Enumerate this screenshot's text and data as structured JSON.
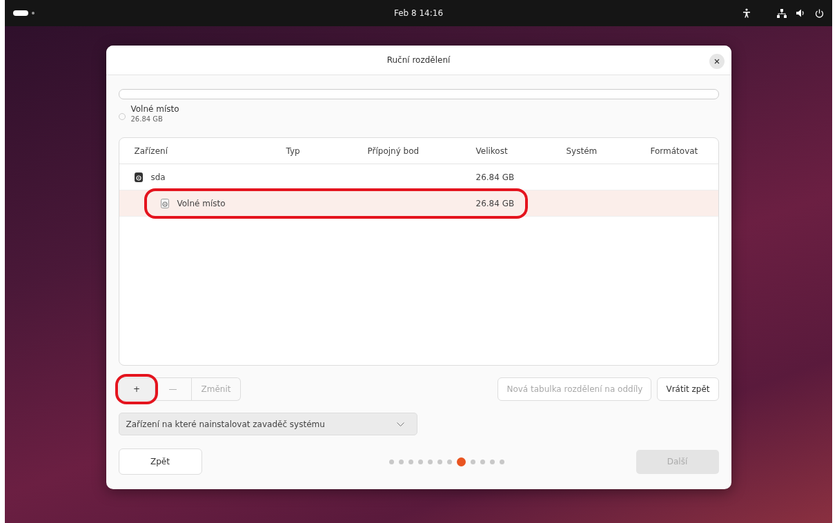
{
  "top_bar": {
    "clock": "Feb 8  14:16"
  },
  "dialog": {
    "title": "Ruční rozdělení",
    "legend": [
      {
        "label": "Volné místo",
        "size": "26.84 GB"
      }
    ],
    "table": {
      "columns": [
        "Zařízení",
        "Typ",
        "Přípojný bod",
        "Velikost",
        "Systém",
        "Formátovat"
      ],
      "rows": [
        {
          "kind": "disk",
          "selected": false,
          "device": "sda",
          "size": "26.84 GB",
          "annotated": false,
          "children": [
            {
              "kind": "free",
              "selected": true,
              "device": "Volné místo",
              "size": "26.84 GB",
              "annotated": true
            }
          ]
        }
      ]
    },
    "edit_buttons": [
      {
        "label": "+",
        "disabled": false,
        "annotated": true
      },
      {
        "label": "—",
        "disabled": true,
        "annotated": false
      },
      {
        "label": "Změnit",
        "disabled": true,
        "annotated": false
      }
    ],
    "right_buttons": [
      {
        "label": "Nová tabulka rozdělení na oddíly",
        "disabled": true
      },
      {
        "label": "Vrátit zpět",
        "disabled": false
      }
    ],
    "bootloader_dropdown": {
      "value": "Zařízení na které nainstalovat zavaděč systému"
    },
    "back_button": {
      "label": "Zpět"
    },
    "pages": [
      {
        "selected": false
      },
      {
        "selected": false
      },
      {
        "selected": false
      },
      {
        "selected": false
      },
      {
        "selected": false
      },
      {
        "selected": false
      },
      {
        "selected": false
      },
      {
        "selected": true
      },
      {
        "selected": false
      },
      {
        "selected": false
      },
      {
        "selected": false
      },
      {
        "selected": false
      }
    ],
    "next_button": {
      "label": "Další",
      "disabled": true
    }
  }
}
